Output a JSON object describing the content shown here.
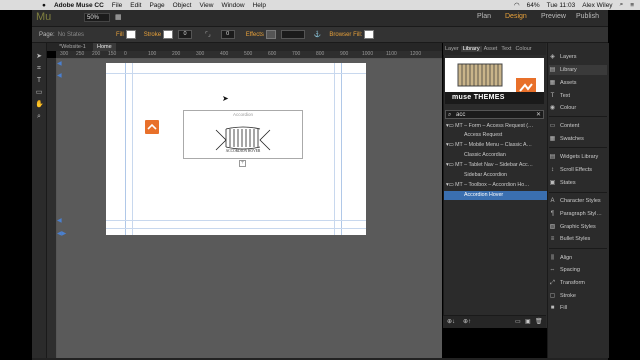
{
  "menubar": {
    "app_name": "Adobe Muse CC",
    "items": [
      "File",
      "Edit",
      "Page",
      "Object",
      "View",
      "Window",
      "Help"
    ],
    "battery": "64%",
    "clock": "Tue 11:03",
    "user": "Alex Wiley"
  },
  "app": {
    "logo": "Mu",
    "zoom": "50%",
    "modes": [
      "Plan",
      "Design",
      "Preview",
      "Publish"
    ]
  },
  "controlbar": {
    "page_label": "Page:",
    "page_state": "No States",
    "fill_label": "Fill",
    "stroke_label": "Stroke",
    "stroke_value": "0",
    "corner_value": "0",
    "effects_label": "Effects",
    "browser_fill_label": "Browser Fill:"
  },
  "doc_tabs": [
    "*Website-1",
    "Home"
  ],
  "ruler_ticks": [
    "300",
    "250",
    "200",
    "150",
    "100",
    "50",
    "0",
    "100",
    "200",
    "300",
    "400",
    "500",
    "600",
    "700",
    "800",
    "900",
    "1000",
    "1100",
    "1200",
    "1300"
  ],
  "canvas": {
    "widget_label": "Accordion",
    "widget_caption": "ACCORDION HOVER"
  },
  "library": {
    "tabs": [
      "Layer",
      "Library",
      "Asset",
      "Text",
      "Colour"
    ],
    "banner_brand": "muse THEMES",
    "search_value": "acc",
    "items": [
      {
        "type": "folder",
        "label": "MT – Form – Access Request (…"
      },
      {
        "type": "child",
        "label": "Access Request"
      },
      {
        "type": "folder",
        "label": "MT – Mobile Menu – Classic A…"
      },
      {
        "type": "child",
        "label": "Classic Accordian"
      },
      {
        "type": "folder",
        "label": "MT – Tablet Nav – Sidebar Acc…"
      },
      {
        "type": "child",
        "label": "Sidebar Accordion"
      },
      {
        "type": "folder",
        "label": "MT – Toolbox – Accordion Ho…"
      },
      {
        "type": "child",
        "label": "Accordion Hover",
        "selected": true
      }
    ]
  },
  "right_panel": {
    "groups": [
      [
        "Layers",
        "Library",
        "Assets",
        "Text",
        "Colour"
      ],
      [
        "Content",
        "Swatches"
      ],
      [
        "Widgets Library",
        "Scroll Effects",
        "States"
      ],
      [
        "Character Styles",
        "Paragraph Styl…",
        "Graphic Styles",
        "Bullet Styles"
      ],
      [
        "Align",
        "Spacing",
        "Transform",
        "Stroke",
        "Fill"
      ]
    ],
    "active": "Library"
  },
  "colors": {
    "accent_orange": "#e8702a",
    "mode_active": "#e8a13a",
    "selection": "#3a6fb0"
  }
}
